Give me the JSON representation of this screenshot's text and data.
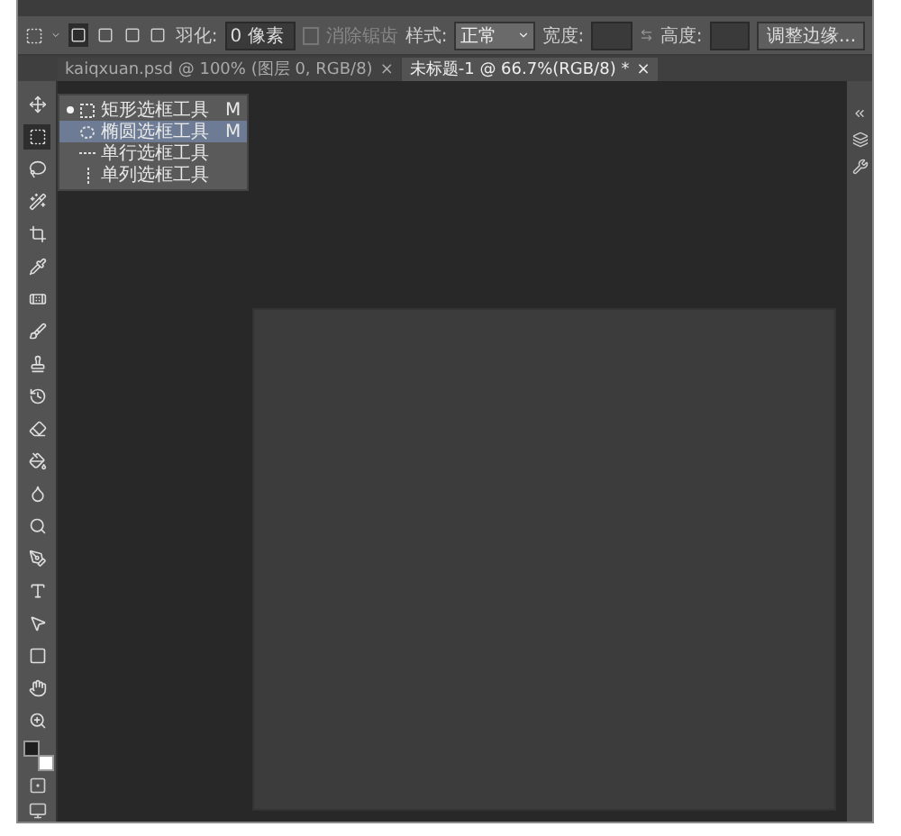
{
  "options_bar": {
    "modes": [
      {
        "selected": true
      },
      {
        "selected": false
      },
      {
        "selected": false
      },
      {
        "selected": false
      }
    ],
    "feather_label": "羽化:",
    "feather_value": "0 像素",
    "antialias": {
      "label": "消除锯齿",
      "checked": false,
      "disabled": true
    },
    "style_label": "样式:",
    "style_value": "正常",
    "width_label": "宽度:",
    "height_label": "高度:",
    "refine_button": "调整边缘..."
  },
  "tabs": [
    {
      "label": "kaiqxuan.psd @ 100% (图层 0, RGB/8)",
      "close": "×",
      "selected": false
    },
    {
      "label": "未标题-1 @ 66.7%(RGB/8) *",
      "close": "×",
      "selected": true
    }
  ],
  "tools": [
    {
      "kind": "move",
      "selected": false
    },
    {
      "kind": "marquee",
      "selected": true
    },
    {
      "kind": "lasso",
      "selected": false
    },
    {
      "kind": "wand",
      "selected": false
    },
    {
      "kind": "crop",
      "selected": false
    },
    {
      "kind": "eyedropper",
      "selected": false
    },
    {
      "kind": "healing",
      "selected": false
    },
    {
      "kind": "brush",
      "selected": false
    },
    {
      "kind": "stamp",
      "selected": false
    },
    {
      "kind": "history",
      "selected": false
    },
    {
      "kind": "eraser",
      "selected": false
    },
    {
      "kind": "bucket",
      "selected": false
    },
    {
      "kind": "blur",
      "selected": false
    },
    {
      "kind": "dodge",
      "selected": false
    },
    {
      "kind": "pen",
      "selected": false
    },
    {
      "kind": "type",
      "selected": false
    },
    {
      "kind": "select",
      "selected": false
    },
    {
      "kind": "shape",
      "selected": false
    },
    {
      "kind": "hand",
      "selected": false
    },
    {
      "kind": "zoom",
      "selected": false
    }
  ],
  "swatches": [
    {
      "color": "#1e1e1e"
    },
    {
      "color": "#ffffff"
    }
  ],
  "flyout": [
    {
      "kind": "rect",
      "label": "矩形选框工具",
      "shortcut": "M",
      "selected": true,
      "highlighted": false
    },
    {
      "kind": "ellipse",
      "label": "椭圆选框工具",
      "shortcut": "M",
      "selected": false,
      "highlighted": true
    },
    {
      "kind": "row",
      "label": "单行选框工具",
      "selected": false,
      "highlighted": false
    },
    {
      "kind": "column",
      "label": "单列选框工具",
      "selected": false,
      "highlighted": false
    }
  ]
}
